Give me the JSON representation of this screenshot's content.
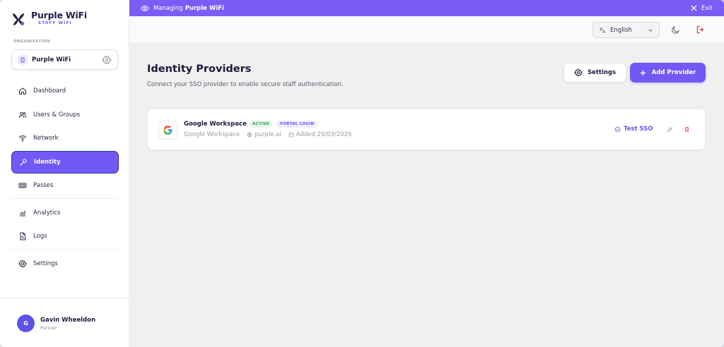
{
  "app": {
    "title": "Purple WiFi",
    "subtitle": "STAFF WIFI"
  },
  "organisation": {
    "label": "ORGANISATION",
    "name": "Purple WiFi"
  },
  "sidebar": {
    "items": [
      {
        "label": "Dashboard",
        "icon": "home-icon"
      },
      {
        "label": "Users & Groups",
        "icon": "users-icon"
      },
      {
        "label": "Network",
        "icon": "wifi-icon"
      },
      {
        "label": "Identity",
        "icon": "key-icon",
        "active": true
      },
      {
        "label": "Passes",
        "icon": "ticket-icon"
      },
      {
        "label": "Analytics",
        "icon": "bar-chart-icon"
      },
      {
        "label": "Logs",
        "icon": "document-icon"
      },
      {
        "label": "Settings",
        "icon": "gear-icon"
      }
    ]
  },
  "user": {
    "initial": "G",
    "name": "Gavin Wheeldon",
    "role": "Partner"
  },
  "banner": {
    "prefix": "Managing",
    "org": "Purple WiFi",
    "exit_label": "Exit"
  },
  "topbar": {
    "language": "English"
  },
  "page": {
    "title": "Identity Providers",
    "description": "Connect your SSO provider to enable secure staff authentication.",
    "settings_label": "Settings",
    "add_label": "Add Provider"
  },
  "providers": [
    {
      "name": "Google Workspace",
      "status": "ACTIVE",
      "tag": "PORTAL LOGIN",
      "type": "Google Workspace",
      "domain": "purple.ai",
      "added": "Added 20/03/2026",
      "test_label": "Test SSO"
    }
  ],
  "colors": {
    "accent": "#7259f5",
    "banner": "#7b5cf4",
    "active_badge": "#2f9e4a",
    "danger": "#e04848"
  }
}
